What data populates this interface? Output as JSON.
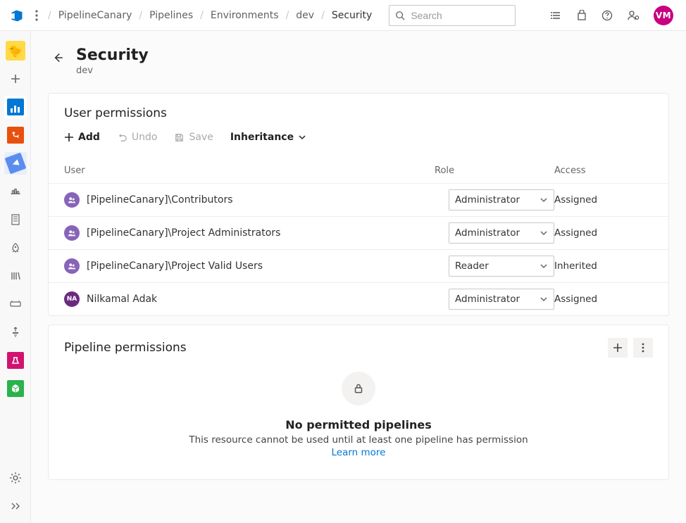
{
  "breadcrumbs": [
    "PipelineCanary",
    "Pipelines",
    "Environments",
    "dev",
    "Security"
  ],
  "search": {
    "placeholder": "Search"
  },
  "topright": {
    "avatar_initials": "VM"
  },
  "page": {
    "title": "Security",
    "subtitle": "dev"
  },
  "user_permissions": {
    "title": "User permissions",
    "toolbar": {
      "add": "Add",
      "undo": "Undo",
      "save": "Save",
      "inheritance": "Inheritance"
    },
    "columns": {
      "user": "User",
      "role": "Role",
      "access": "Access"
    },
    "rows": [
      {
        "name": "[PipelineCanary]\\Contributors",
        "type": "group",
        "role": "Administrator",
        "access": "Assigned"
      },
      {
        "name": "[PipelineCanary]\\Project Administrators",
        "type": "group",
        "role": "Administrator",
        "access": "Assigned"
      },
      {
        "name": "[PipelineCanary]\\Project Valid Users",
        "type": "group",
        "role": "Reader",
        "access": "Inherited"
      },
      {
        "name": "Nilkamal Adak",
        "type": "person",
        "initials": "NA",
        "role": "Administrator",
        "access": "Assigned"
      }
    ]
  },
  "pipeline_permissions": {
    "title": "Pipeline permissions",
    "empty": {
      "title": "No permitted pipelines",
      "message": "This resource cannot be used until at least one pipeline has permission",
      "learn_more": "Learn more"
    }
  }
}
